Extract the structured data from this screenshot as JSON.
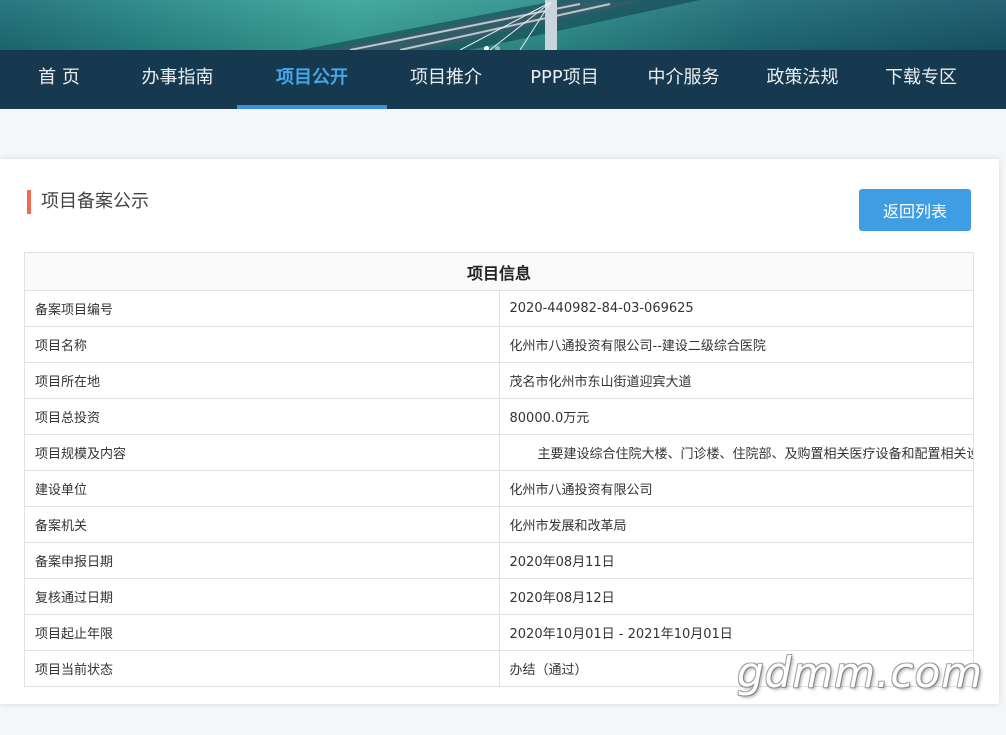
{
  "nav": {
    "items": [
      {
        "label": "首 页",
        "active": false
      },
      {
        "label": "办事指南",
        "active": false
      },
      {
        "label": "项目公开",
        "active": true
      },
      {
        "label": "项目推介",
        "active": false
      },
      {
        "label": "PPP项目",
        "active": false
      },
      {
        "label": "中介服务",
        "active": false
      },
      {
        "label": "政策法规",
        "active": false
      },
      {
        "label": "下载专区",
        "active": false
      }
    ]
  },
  "section": {
    "title": "项目备案公示",
    "back_button": "返回列表"
  },
  "table": {
    "header": "项目信息",
    "rows": [
      {
        "label": "备案项目编号",
        "value": "2020-440982-84-03-069625"
      },
      {
        "label": "项目名称",
        "value": "化州市八通投资有限公司--建设二级综合医院"
      },
      {
        "label": "项目所在地",
        "value": "茂名市化州市东山街道迎宾大道"
      },
      {
        "label": "项目总投资",
        "value": "80000.0万元"
      },
      {
        "label": "项目规模及内容",
        "value": "主要建设综合住院大楼、门诊楼、住院部、及购置相关医疗设备和配置相关设施等"
      },
      {
        "label": "建设单位",
        "value": "化州市八通投资有限公司"
      },
      {
        "label": "备案机关",
        "value": "化州市发展和改革局"
      },
      {
        "label": "备案申报日期",
        "value": "2020年08月11日"
      },
      {
        "label": "复核通过日期",
        "value": "2020年08月12日"
      },
      {
        "label": "项目起止年限",
        "value": "2020年10月01日 - 2021年10月01日"
      },
      {
        "label": "项目当前状态",
        "value": "办结（通过）"
      }
    ]
  },
  "watermark": "gdmm.com",
  "colors": {
    "nav_bg": "#16394f",
    "nav_active": "#46a6ea",
    "accent_bar": "#f06a4e",
    "button": "#3f9de3"
  }
}
